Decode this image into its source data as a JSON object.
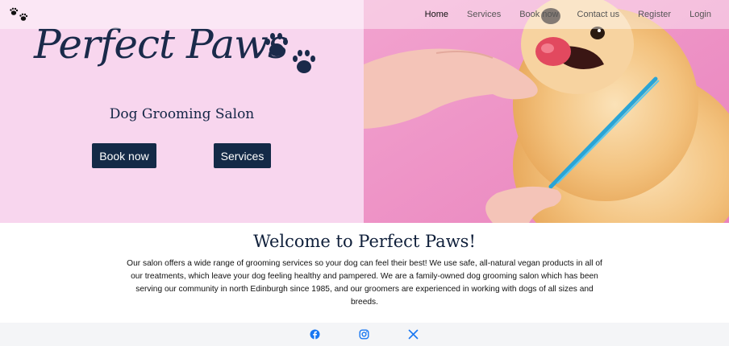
{
  "nav": {
    "links": [
      "Home",
      "Services",
      "Book now",
      "Contact us",
      "Register",
      "Login"
    ],
    "active": "Home"
  },
  "hero": {
    "logo": "Perfect Paws",
    "tagline": "Dog Grooming Salon",
    "buttons": {
      "book": "Book now",
      "services": "Services"
    }
  },
  "welcome": {
    "heading": "Welcome to Perfect Paws!",
    "text": "Our salon offers a wide range of grooming services so your dog can feel their best! We use safe, all-natural vegan products in all of our treatments, which leave your dog feeling healthy and pampered. We are a family-owned dog grooming salon which has been serving our community in north Edinburgh since 1985, and our groomers are experienced in working with dogs of all sizes and breeds."
  },
  "footer": {
    "social_icons": [
      "facebook-icon",
      "instagram-icon",
      "x-icon"
    ]
  },
  "colors": {
    "hero_background": "#f8d6ee",
    "photo_background": "#ee95c6",
    "button": "#142a47",
    "social": "#1877f2",
    "footer_background": "#f4f5f7"
  }
}
